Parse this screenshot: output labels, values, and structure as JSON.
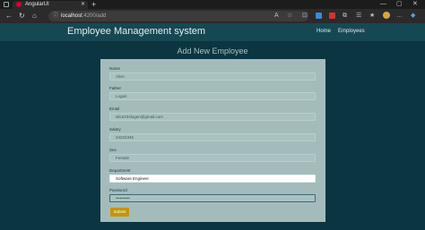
{
  "browser": {
    "tab_title": "AngularUI",
    "url_host": "localhost",
    "url_path": ":4200/add"
  },
  "app": {
    "brand": "Employee Management system",
    "nav": {
      "home": "Home",
      "employees": "Employees"
    }
  },
  "page": {
    "title": "Add New Employee",
    "fields": {
      "name": {
        "label": "Name",
        "value": "Alice"
      },
      "father": {
        "label": "Father",
        "value": "Logan"
      },
      "email": {
        "label": "Email",
        "value": "alice234logan@gmail.com"
      },
      "salary": {
        "label": "Salary",
        "value": "34232345"
      },
      "sex": {
        "label": "Sex",
        "value": "Female"
      },
      "department": {
        "label": "Department",
        "value": "Software Engineer"
      },
      "password": {
        "label": "Password",
        "value": "••••••••••"
      }
    },
    "submit_label": "Submit"
  },
  "colors": {
    "page_bg": "#0b3540",
    "navbar_bg": "#164854",
    "card_bg": "#a3bcbb",
    "submit_bg": "#c79407",
    "angular_red": "#dd0031"
  }
}
